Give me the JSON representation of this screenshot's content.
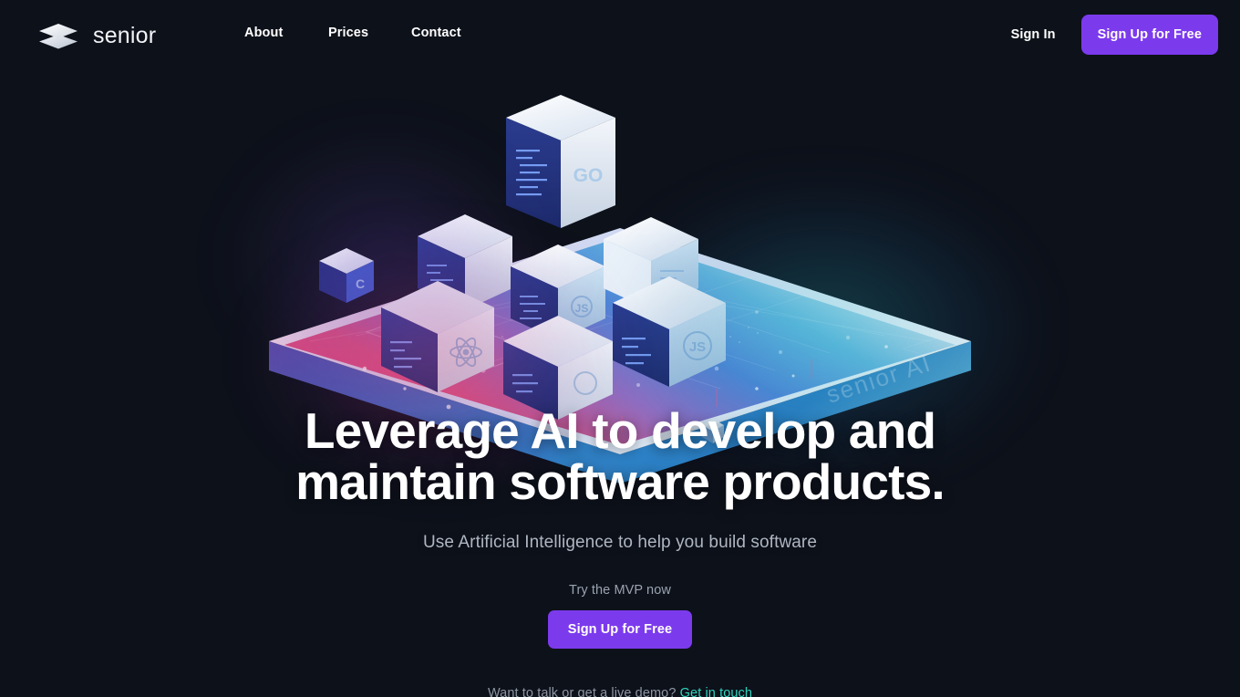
{
  "brand": {
    "name": "senior",
    "logo_icon": "layers-stack-icon"
  },
  "nav": {
    "items": [
      {
        "label": "About",
        "name": "nav-item-about"
      },
      {
        "label": "Prices",
        "name": "nav-item-prices"
      },
      {
        "label": "Contact",
        "name": "nav-item-contact"
      }
    ]
  },
  "header_actions": {
    "sign_in_label": "Sign In",
    "sign_up_label": "Sign Up for Free"
  },
  "hero": {
    "headline_line1": "Leverage AI to develop and",
    "headline_line2": "maintain software products.",
    "subhead": "Use Artificial Intelligence to help you build software",
    "cta_kicker": "Try the MVP now",
    "cta_label": "Sign Up for Free",
    "demo_text": "Want to talk or get a live demo?",
    "demo_link_label": "Get in touch",
    "illustration": {
      "name": "isometric-ai-platform-illustration",
      "platform_label": "senior AI",
      "cube_labels": [
        "GO",
        "React",
        "JS",
        "C"
      ]
    }
  },
  "colors": {
    "page_background": "#0d111a",
    "accent_purple": "#7c3aed",
    "link_teal": "#2dd4bf",
    "text_primary": "#ffffff",
    "text_muted": "#9aa3b0",
    "art_pink": "#e8457c",
    "art_blue": "#2f6fd0",
    "art_teal": "#3fb6c4"
  }
}
